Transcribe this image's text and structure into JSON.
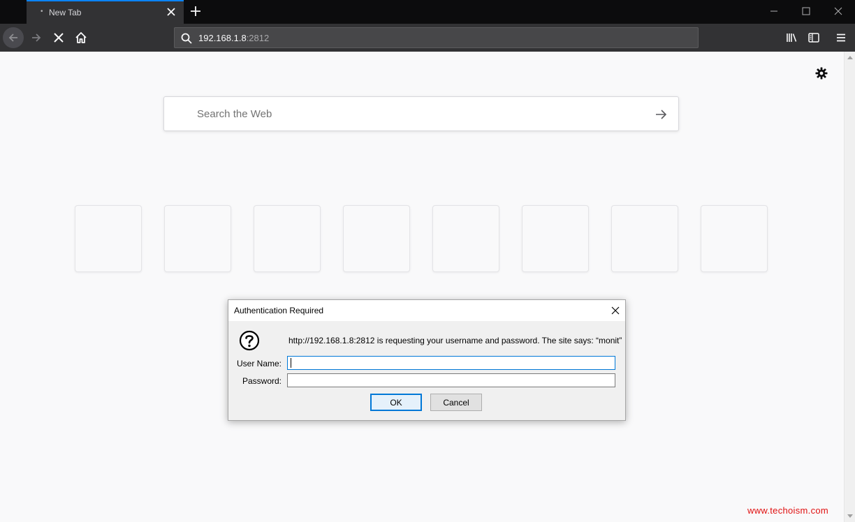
{
  "tab": {
    "title": "New Tab"
  },
  "urlbar": {
    "host": "192.168.1.8",
    "port": ":2812"
  },
  "search": {
    "placeholder": "Search the Web"
  },
  "top_sites": {
    "tile_count": 8
  },
  "dialog": {
    "title": "Authentication Required",
    "message": "http://192.168.1.8:2812 is requesting your username and password. The site says: “monit”",
    "username_label": "User Name:",
    "password_label": "Password:",
    "username_value": "",
    "password_value": "",
    "ok_label": "OK",
    "cancel_label": "Cancel"
  },
  "watermark": "www.techoism.com",
  "colors": {
    "accent": "#0a84ff",
    "toolbar": "#323234",
    "tabstrip": "#0c0c0d",
    "focus": "#0078d7",
    "watermark": "#e01010"
  },
  "icons": [
    "close-icon",
    "plus-icon",
    "minimize-icon",
    "maximize-icon",
    "back-arrow-icon",
    "forward-arrow-icon",
    "stop-icon",
    "home-icon",
    "search-icon",
    "library-icon",
    "sidebar-icon",
    "menu-icon",
    "gear-icon",
    "arrow-right-icon",
    "question-icon"
  ]
}
